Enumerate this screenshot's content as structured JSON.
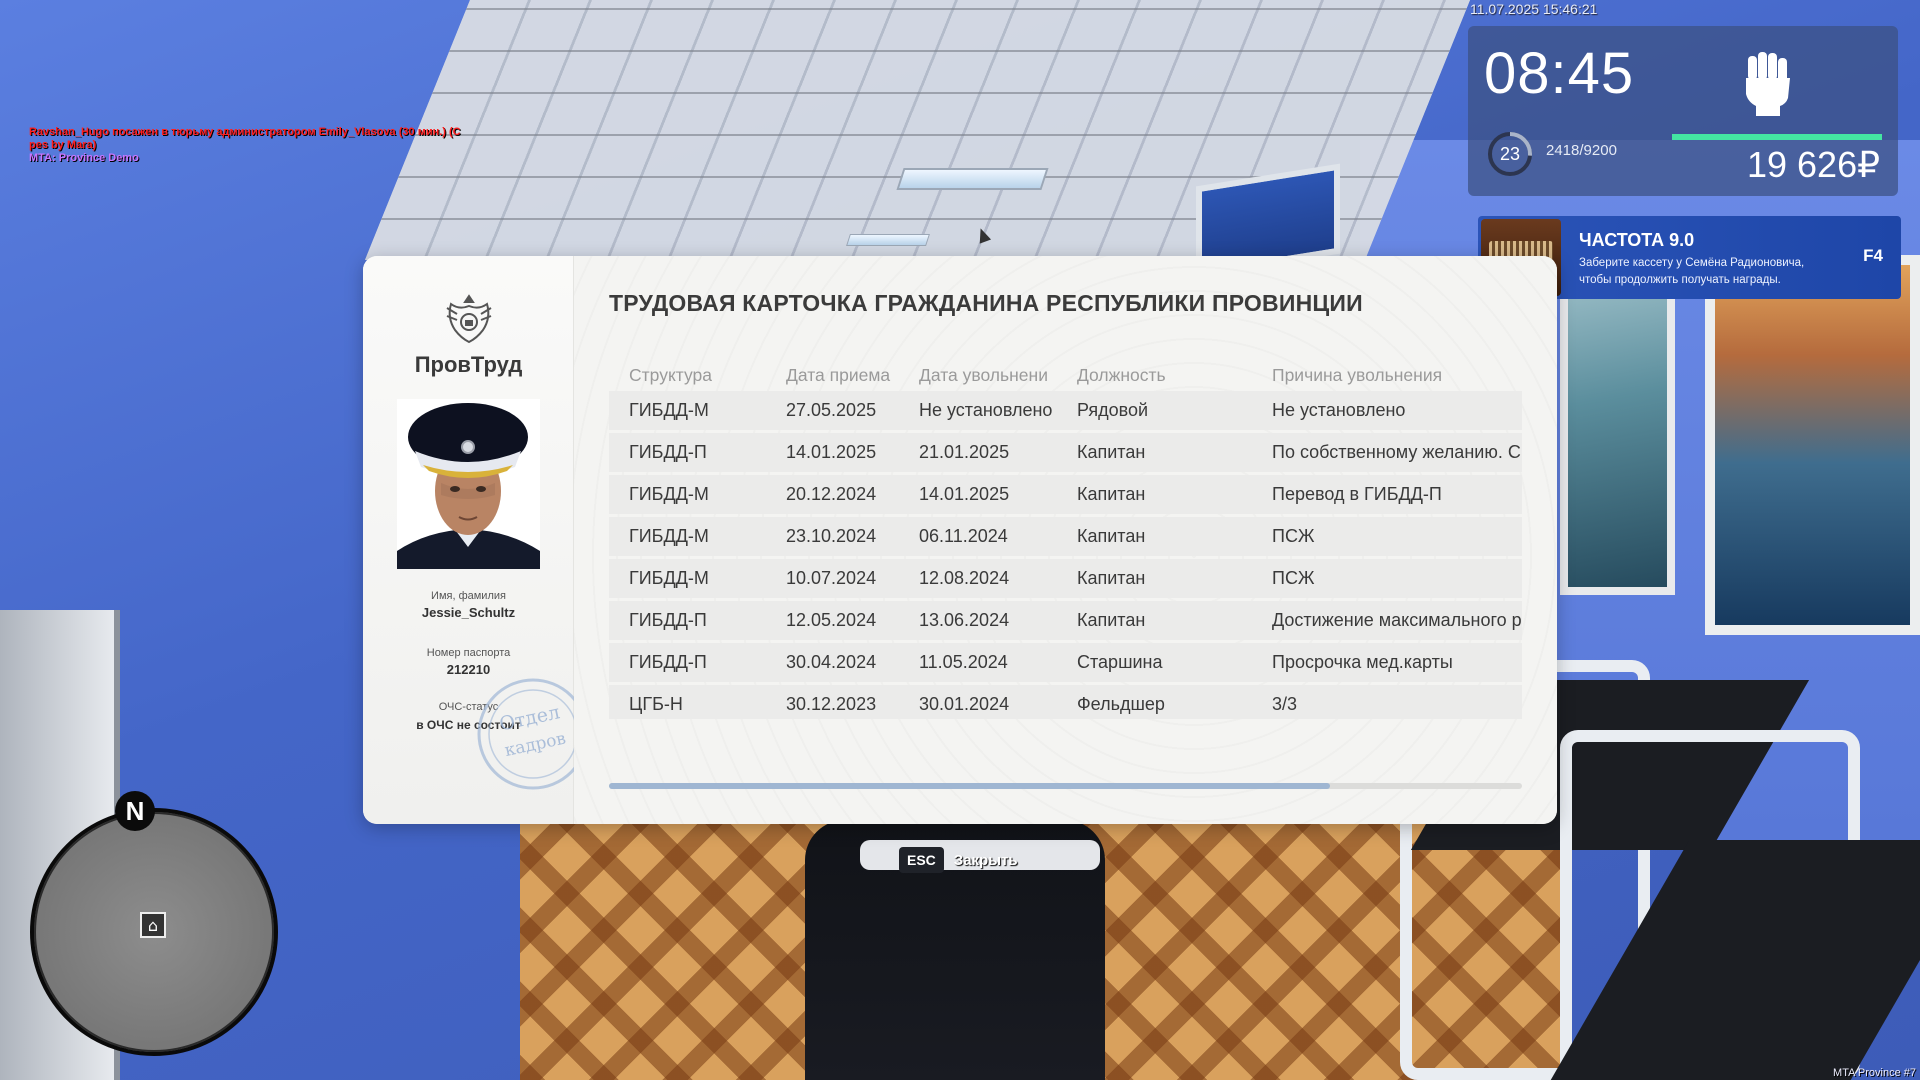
{
  "chat": {
    "lines": [
      {
        "text": "Ravshan_Hugo посажен в тюрьму администратором Emily_Vlasova (30 мин.) (C",
        "color": "#ff1f1f"
      },
      {
        "text": "pes by Mara)",
        "color": "#ff1f1f"
      },
      {
        "text": "MTA: Province Demo",
        "color": "#c875ff"
      }
    ]
  },
  "hud": {
    "datetime": "11.07.2025 15:46:21",
    "time": "08:45",
    "level": "23",
    "experience": "2418/9200",
    "money": "19 626₽",
    "accent_color": "#44e6a2"
  },
  "frequency": {
    "title": "ЧАСТОТА 9.0",
    "description": "Заберите кассету у Семёна Радионовича, чтобы продолжить получать награды.",
    "key": "F4"
  },
  "card": {
    "brand": "ПровТруд",
    "title": "ТРУДОВАЯ КАРТОЧКА ГРАЖДАНИНА РЕСПУБЛИКИ ПРОВИНЦИИ",
    "name_label": "Имя, фамилия",
    "name_value": "Jessie_Schultz",
    "passport_label": "Номер паспорта",
    "passport_value": "212210",
    "status_label": "ОЧС-статус",
    "status_value": "в ОЧС не состоит",
    "stamp_text_top": "Отдел",
    "stamp_text_bottom": "кадров",
    "columns": [
      "Структура",
      "Дата приема",
      "Дата увольнени",
      "Должность",
      "Причина увольнения"
    ],
    "rows": [
      [
        "ГИБДД-М",
        "27.05.2025",
        "Не установлено",
        "Рядовой",
        "Не установлено"
      ],
      [
        "ГИБДД-П",
        "14.01.2025",
        "21.01.2025",
        "Капитан",
        "По собственному желанию. С"
      ],
      [
        "ГИБДД-М",
        "20.12.2024",
        "14.01.2025",
        "Капитан",
        "Перевод в ГИБДД-П"
      ],
      [
        "ГИБДД-М",
        "23.10.2024",
        "06.11.2024",
        "Капитан",
        "ПСЖ"
      ],
      [
        "ГИБДД-М",
        "10.07.2024",
        "12.08.2024",
        "Капитан",
        "ПСЖ"
      ],
      [
        "ГИБДД-П",
        "12.05.2024",
        "13.06.2024",
        "Капитан",
        "Достижение максимального р"
      ],
      [
        "ГИБДД-П",
        "30.04.2024",
        "11.05.2024",
        "Старшина",
        "Просрочка мед.карты"
      ],
      [
        "ЦГБ-Н",
        "30.12.2023",
        "30.01.2024",
        "Фельдшер",
        "3/3"
      ]
    ]
  },
  "controls": {
    "esc_key": "ESC",
    "esc_label": "Закрыть"
  },
  "minimap": {
    "north_label": "N"
  },
  "footer": "MTA Province #7"
}
